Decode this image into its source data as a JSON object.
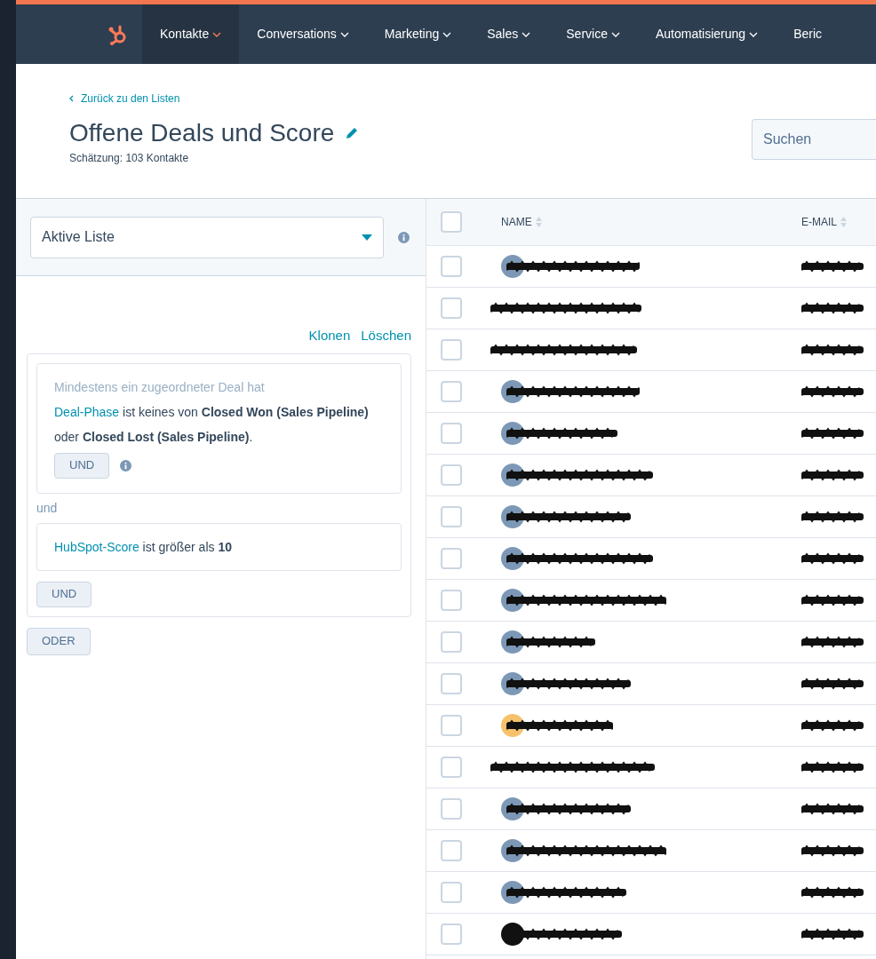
{
  "nav": {
    "items": [
      {
        "label": "Kontakte",
        "selected": true
      },
      {
        "label": "Conversations",
        "selected": false
      },
      {
        "label": "Marketing",
        "selected": false
      },
      {
        "label": "Sales",
        "selected": false
      },
      {
        "label": "Service",
        "selected": false
      },
      {
        "label": "Automatisierung",
        "selected": false
      },
      {
        "label": "Beric",
        "selected": false
      }
    ]
  },
  "header": {
    "back_link": "Zurück zu den Listen",
    "title": "Offene Deals und Score",
    "estimate": "Schätzung: 103 Kontakte",
    "search": {
      "placeholder": "Suchen"
    }
  },
  "filter_panel": {
    "list_type": "Aktive Liste",
    "actions": [
      "Klonen",
      "Löschen"
    ],
    "group": {
      "conditions": [
        {
          "intro": "Mindestens ein zugeordneter Deal hat",
          "field": "Deal-Phase",
          "text": "ist keines von **Closed Won (Sales Pipeline)** oder **Closed Lost (Sales Pipeline)**.",
          "and_button": "UND"
        },
        {
          "field": "HubSpot-Score",
          "text": "ist größer als **10**"
        }
      ],
      "joiner": "und",
      "and_button": "UND"
    },
    "or_button": "ODER"
  },
  "table": {
    "select_all_checked": false,
    "columns": [
      "NAME",
      "E-MAIL"
    ],
    "rows": [
      {
        "checked": false,
        "color": "#7c98b6"
      },
      {
        "checked": false
      },
      {
        "checked": false
      },
      {
        "checked": false,
        "color": "#7c98b6"
      },
      {
        "checked": false,
        "color": "#7c98b6"
      },
      {
        "checked": false,
        "color": "#7c98b6"
      },
      {
        "checked": false,
        "color": "#7c98b6"
      },
      {
        "checked": false,
        "color": "#7c98b6"
      },
      {
        "checked": false,
        "color": "#7c98b6"
      },
      {
        "checked": false,
        "color": "#7c98b6"
      },
      {
        "checked": false,
        "color": "#7c98b6"
      },
      {
        "checked": false,
        "color": "#f5c26b"
      },
      {
        "checked": false
      },
      {
        "checked": false,
        "color": "#7c98b6"
      },
      {
        "checked": false,
        "color": "#7c98b6"
      },
      {
        "checked": false,
        "color": "#7c98b6"
      },
      {
        "checked": false,
        "color": "#111111"
      }
    ]
  }
}
